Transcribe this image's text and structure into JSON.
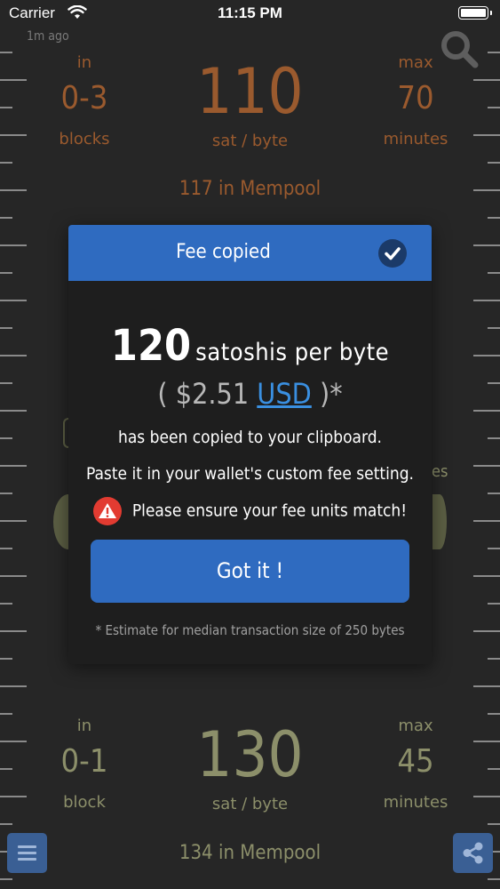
{
  "status_bar": {
    "carrier": "Carrier",
    "time": "11:15 PM"
  },
  "header": {
    "updated": "1m ago",
    "search_icon": "search-icon"
  },
  "tier_top": {
    "in_label": "in",
    "blocks_value": "0-3",
    "blocks_unit": "blocks",
    "fee_value": "110",
    "fee_unit": "sat / byte",
    "max_label": "max",
    "minutes_value": "70",
    "minutes_unit": "minutes",
    "mempool_count": "117",
    "mempool_label": "in Mempool",
    "color": "#9a5a2e"
  },
  "tier_bottom": {
    "in_label": "in",
    "blocks_value": "0-1",
    "blocks_unit": "block",
    "fee_value": "130",
    "fee_unit": "sat / byte",
    "max_label": "max",
    "minutes_value": "45",
    "minutes_unit": "minutes",
    "mempool_count": "134",
    "mempool_label": "in Mempool",
    "color": "#8c8f6a"
  },
  "modal": {
    "title": "Fee copied",
    "fee_value": "120",
    "fee_unit": "satoshis per byte",
    "usd_open": "( $2.51",
    "usd_link": "USD",
    "usd_close": ")*",
    "line1": "has been copied to your clipboard.",
    "line2": "Paste it in your wallet's custom fee setting.",
    "warning": "Please ensure your fee units match!",
    "button": "Got it !",
    "footnote": "* Estimate for median transaction size of 250 bytes",
    "accent": "#2f6bc0",
    "warning_color": "#e23b31"
  },
  "toolbar": {
    "menu_icon": "menu-icon",
    "share_icon": "share-icon"
  }
}
